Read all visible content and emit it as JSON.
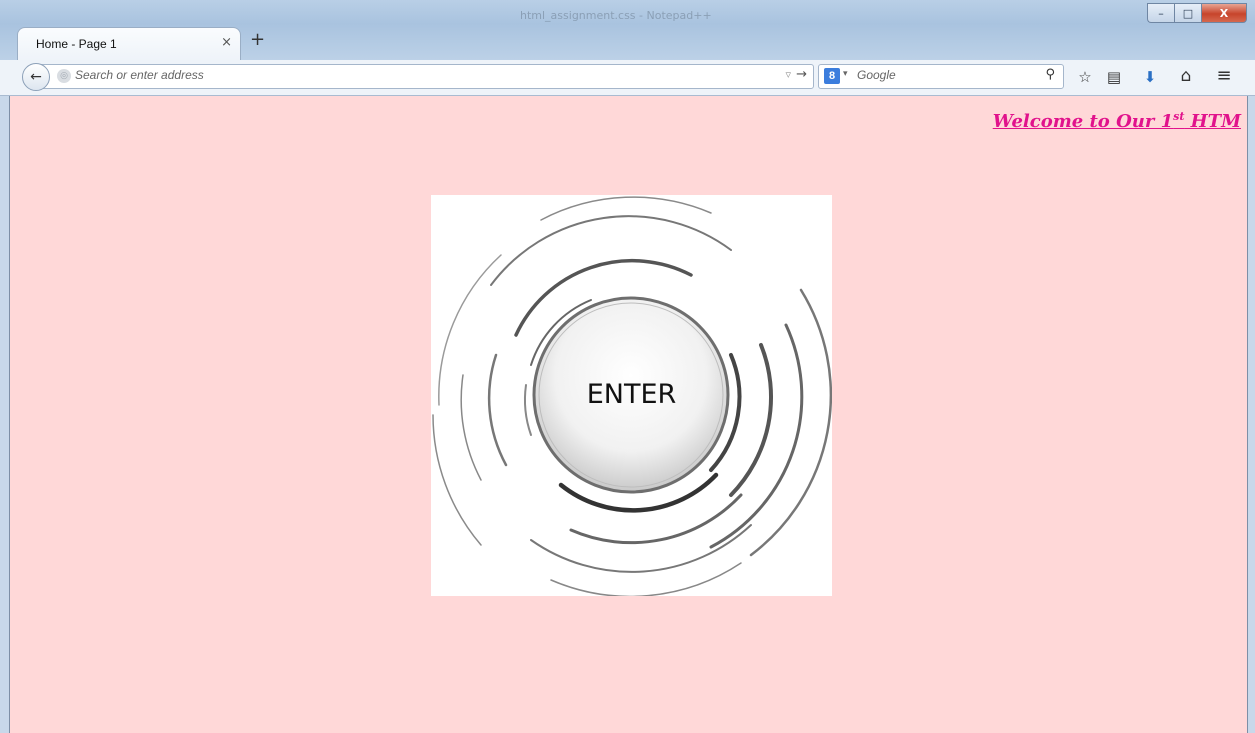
{
  "window": {
    "title_text": "html_assignment.css - Notepad++",
    "minimize_glyph": "–",
    "maximize_glyph": "□",
    "close_glyph": "X"
  },
  "tab": {
    "title": "Home - Page 1",
    "close_glyph": "×",
    "new_tab_glyph": "+"
  },
  "navbar": {
    "back_glyph": "←",
    "address_placeholder": "Search or enter address",
    "dropdown_glyph": "▿",
    "go_glyph": "→",
    "search_engine_badge": "8",
    "search_engine_dropdown": "▾",
    "search_placeholder": "Google",
    "search_glyph": "⚲",
    "bookmark_star_glyph": "☆",
    "clipboard_glyph": "▤",
    "download_glyph": "⬇",
    "home_glyph": "⌂",
    "menu_glyph": "≡"
  },
  "page": {
    "welcome_prefix": "Welcome to Our 1",
    "welcome_sup": "st",
    "welcome_suffix": " HTM",
    "enter_label": "ENTER",
    "background_color": "#ffd8d8",
    "welcome_color": "#e1128c"
  }
}
